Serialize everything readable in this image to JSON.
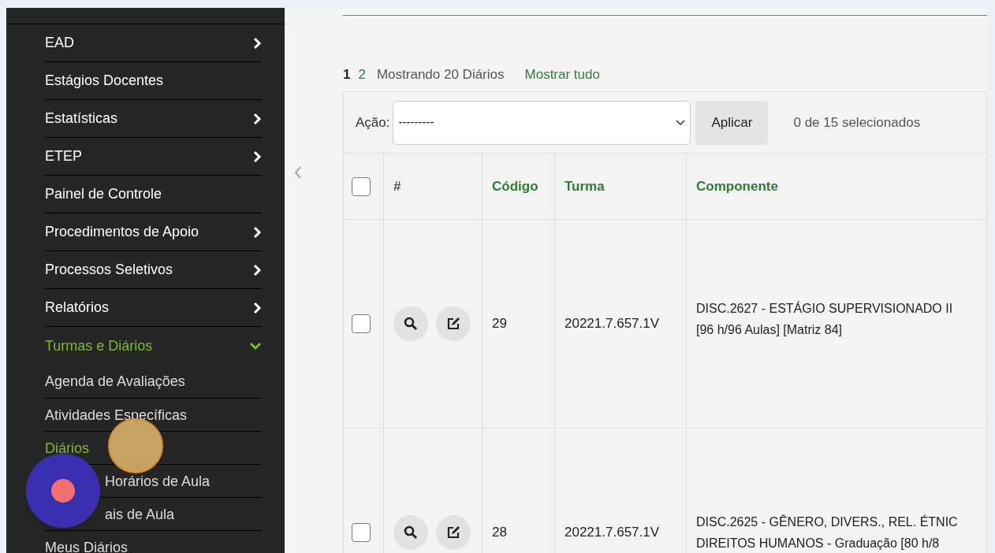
{
  "sidebar": {
    "items": [
      {
        "label": "EAD",
        "has_submenu": true,
        "expanded": false
      },
      {
        "label": "Estágios Docentes",
        "has_submenu": false,
        "expanded": false
      },
      {
        "label": "Estatísticas",
        "has_submenu": true,
        "expanded": false
      },
      {
        "label": "ETEP",
        "has_submenu": true,
        "expanded": false
      },
      {
        "label": "Painel de Controle",
        "has_submenu": false,
        "expanded": false
      },
      {
        "label": "Procedimentos de Apoio",
        "has_submenu": true,
        "expanded": false
      },
      {
        "label": "Processos Seletivos",
        "has_submenu": true,
        "expanded": false
      },
      {
        "label": "Relatórios",
        "has_submenu": true,
        "expanded": false
      },
      {
        "label": "Turmas e Diários",
        "has_submenu": true,
        "expanded": true,
        "children": [
          {
            "label": "Agenda de Avaliações",
            "selected": false
          },
          {
            "label": "Atividades Específicas",
            "selected": false
          },
          {
            "label": "Diários",
            "selected": true
          },
          {
            "label": "Horários de Aula",
            "selected": false
          },
          {
            "label": "ais de Aula",
            "selected": false
          },
          {
            "label": "Meus Diários",
            "selected": false
          }
        ]
      }
    ]
  },
  "pagination": {
    "pages": [
      {
        "label": "1",
        "selected": true
      },
      {
        "label": "2",
        "selected": false
      }
    ],
    "summary": "Mostrando 20 Diários",
    "show_all": "Mostrar tudo"
  },
  "actions": {
    "label": "Ação:",
    "value": "---------",
    "button": "Aplicar",
    "selection_count": "0 de 15 selecionados"
  },
  "table": {
    "select_all_checked": false,
    "columns": [
      "#",
      "Código",
      "Turma",
      "Componente"
    ],
    "rows": [
      {
        "checked": false,
        "code": "29",
        "turma": "20221.7.657.1V",
        "componente": [
          "DISC.2627 - ESTÁGIO SUPERVISIONADO II",
          "[96 h/96 Aulas] [Matriz 84]"
        ]
      },
      {
        "checked": false,
        "code": "28",
        "turma": "20221.7.657.1V",
        "componente": [
          "DISC.2625 - GÊNERO, DIVERS., REL. ÉTNIC",
          "DIREITOS HUMANOS - Graduação [80 h/8"
        ]
      }
    ]
  }
}
